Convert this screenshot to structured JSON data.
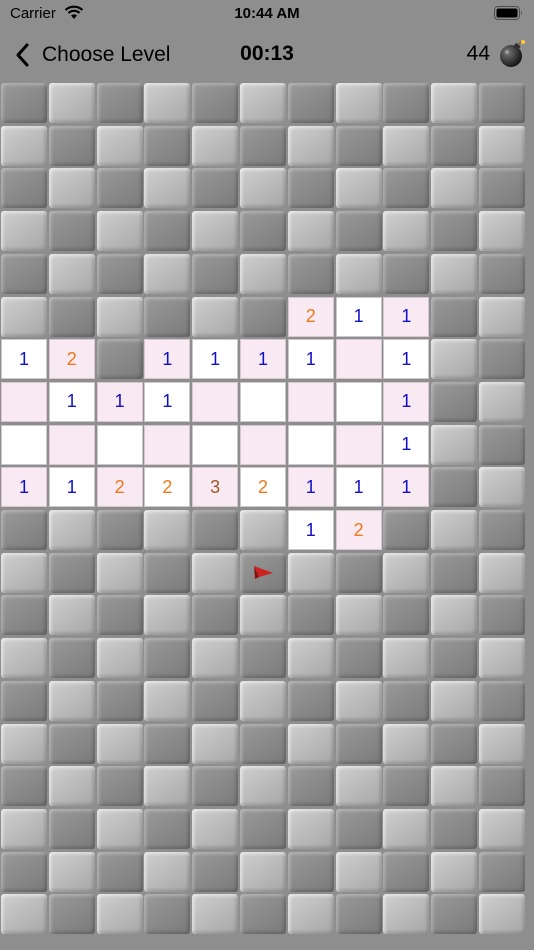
{
  "status_bar": {
    "carrier": "Carrier",
    "time": "10:44 AM"
  },
  "nav": {
    "back_label": "Choose Level",
    "timer": "00:13",
    "mines_left": "44"
  },
  "board": {
    "cols": 11,
    "rows": 20,
    "number_colors": {
      "1": "#1010c8",
      "2": "#f07818",
      "3": "#a05828"
    },
    "revealed": [
      {
        "r": 5,
        "c": 6,
        "v": "2",
        "bg": "pink"
      },
      {
        "r": 5,
        "c": 7,
        "v": "1",
        "bg": "white"
      },
      {
        "r": 5,
        "c": 8,
        "v": "1",
        "bg": "pink"
      },
      {
        "r": 6,
        "c": 0,
        "v": "1",
        "bg": "white"
      },
      {
        "r": 6,
        "c": 1,
        "v": "2",
        "bg": "pink"
      },
      {
        "r": 6,
        "c": 3,
        "v": "1",
        "bg": "pink"
      },
      {
        "r": 6,
        "c": 4,
        "v": "1",
        "bg": "white"
      },
      {
        "r": 6,
        "c": 5,
        "v": "1",
        "bg": "pink"
      },
      {
        "r": 6,
        "c": 6,
        "v": "1",
        "bg": "white"
      },
      {
        "r": 6,
        "c": 7,
        "v": "",
        "bg": "pink"
      },
      {
        "r": 6,
        "c": 8,
        "v": "1",
        "bg": "white"
      },
      {
        "r": 7,
        "c": 0,
        "v": "",
        "bg": "pink"
      },
      {
        "r": 7,
        "c": 1,
        "v": "1",
        "bg": "white"
      },
      {
        "r": 7,
        "c": 2,
        "v": "1",
        "bg": "pink"
      },
      {
        "r": 7,
        "c": 3,
        "v": "1",
        "bg": "white"
      },
      {
        "r": 7,
        "c": 4,
        "v": "",
        "bg": "pink"
      },
      {
        "r": 7,
        "c": 5,
        "v": "",
        "bg": "white"
      },
      {
        "r": 7,
        "c": 6,
        "v": "",
        "bg": "pink"
      },
      {
        "r": 7,
        "c": 7,
        "v": "",
        "bg": "white"
      },
      {
        "r": 7,
        "c": 8,
        "v": "1",
        "bg": "pink"
      },
      {
        "r": 8,
        "c": 0,
        "v": "",
        "bg": "white"
      },
      {
        "r": 8,
        "c": 1,
        "v": "",
        "bg": "pink"
      },
      {
        "r": 8,
        "c": 2,
        "v": "",
        "bg": "white"
      },
      {
        "r": 8,
        "c": 3,
        "v": "",
        "bg": "pink"
      },
      {
        "r": 8,
        "c": 4,
        "v": "",
        "bg": "white"
      },
      {
        "r": 8,
        "c": 5,
        "v": "",
        "bg": "pink"
      },
      {
        "r": 8,
        "c": 6,
        "v": "",
        "bg": "white"
      },
      {
        "r": 8,
        "c": 7,
        "v": "",
        "bg": "pink"
      },
      {
        "r": 8,
        "c": 8,
        "v": "1",
        "bg": "white"
      },
      {
        "r": 9,
        "c": 0,
        "v": "1",
        "bg": "pink"
      },
      {
        "r": 9,
        "c": 1,
        "v": "1",
        "bg": "white"
      },
      {
        "r": 9,
        "c": 2,
        "v": "2",
        "bg": "pink"
      },
      {
        "r": 9,
        "c": 3,
        "v": "2",
        "bg": "white"
      },
      {
        "r": 9,
        "c": 4,
        "v": "3",
        "bg": "pink"
      },
      {
        "r": 9,
        "c": 5,
        "v": "2",
        "bg": "white"
      },
      {
        "r": 9,
        "c": 6,
        "v": "1",
        "bg": "pink"
      },
      {
        "r": 9,
        "c": 7,
        "v": "1",
        "bg": "white"
      },
      {
        "r": 9,
        "c": 8,
        "v": "1",
        "bg": "pink"
      },
      {
        "r": 10,
        "c": 6,
        "v": "1",
        "bg": "white"
      },
      {
        "r": 10,
        "c": 7,
        "v": "2",
        "bg": "pink"
      }
    ],
    "flags": [
      {
        "r": 11,
        "c": 5
      }
    ]
  }
}
